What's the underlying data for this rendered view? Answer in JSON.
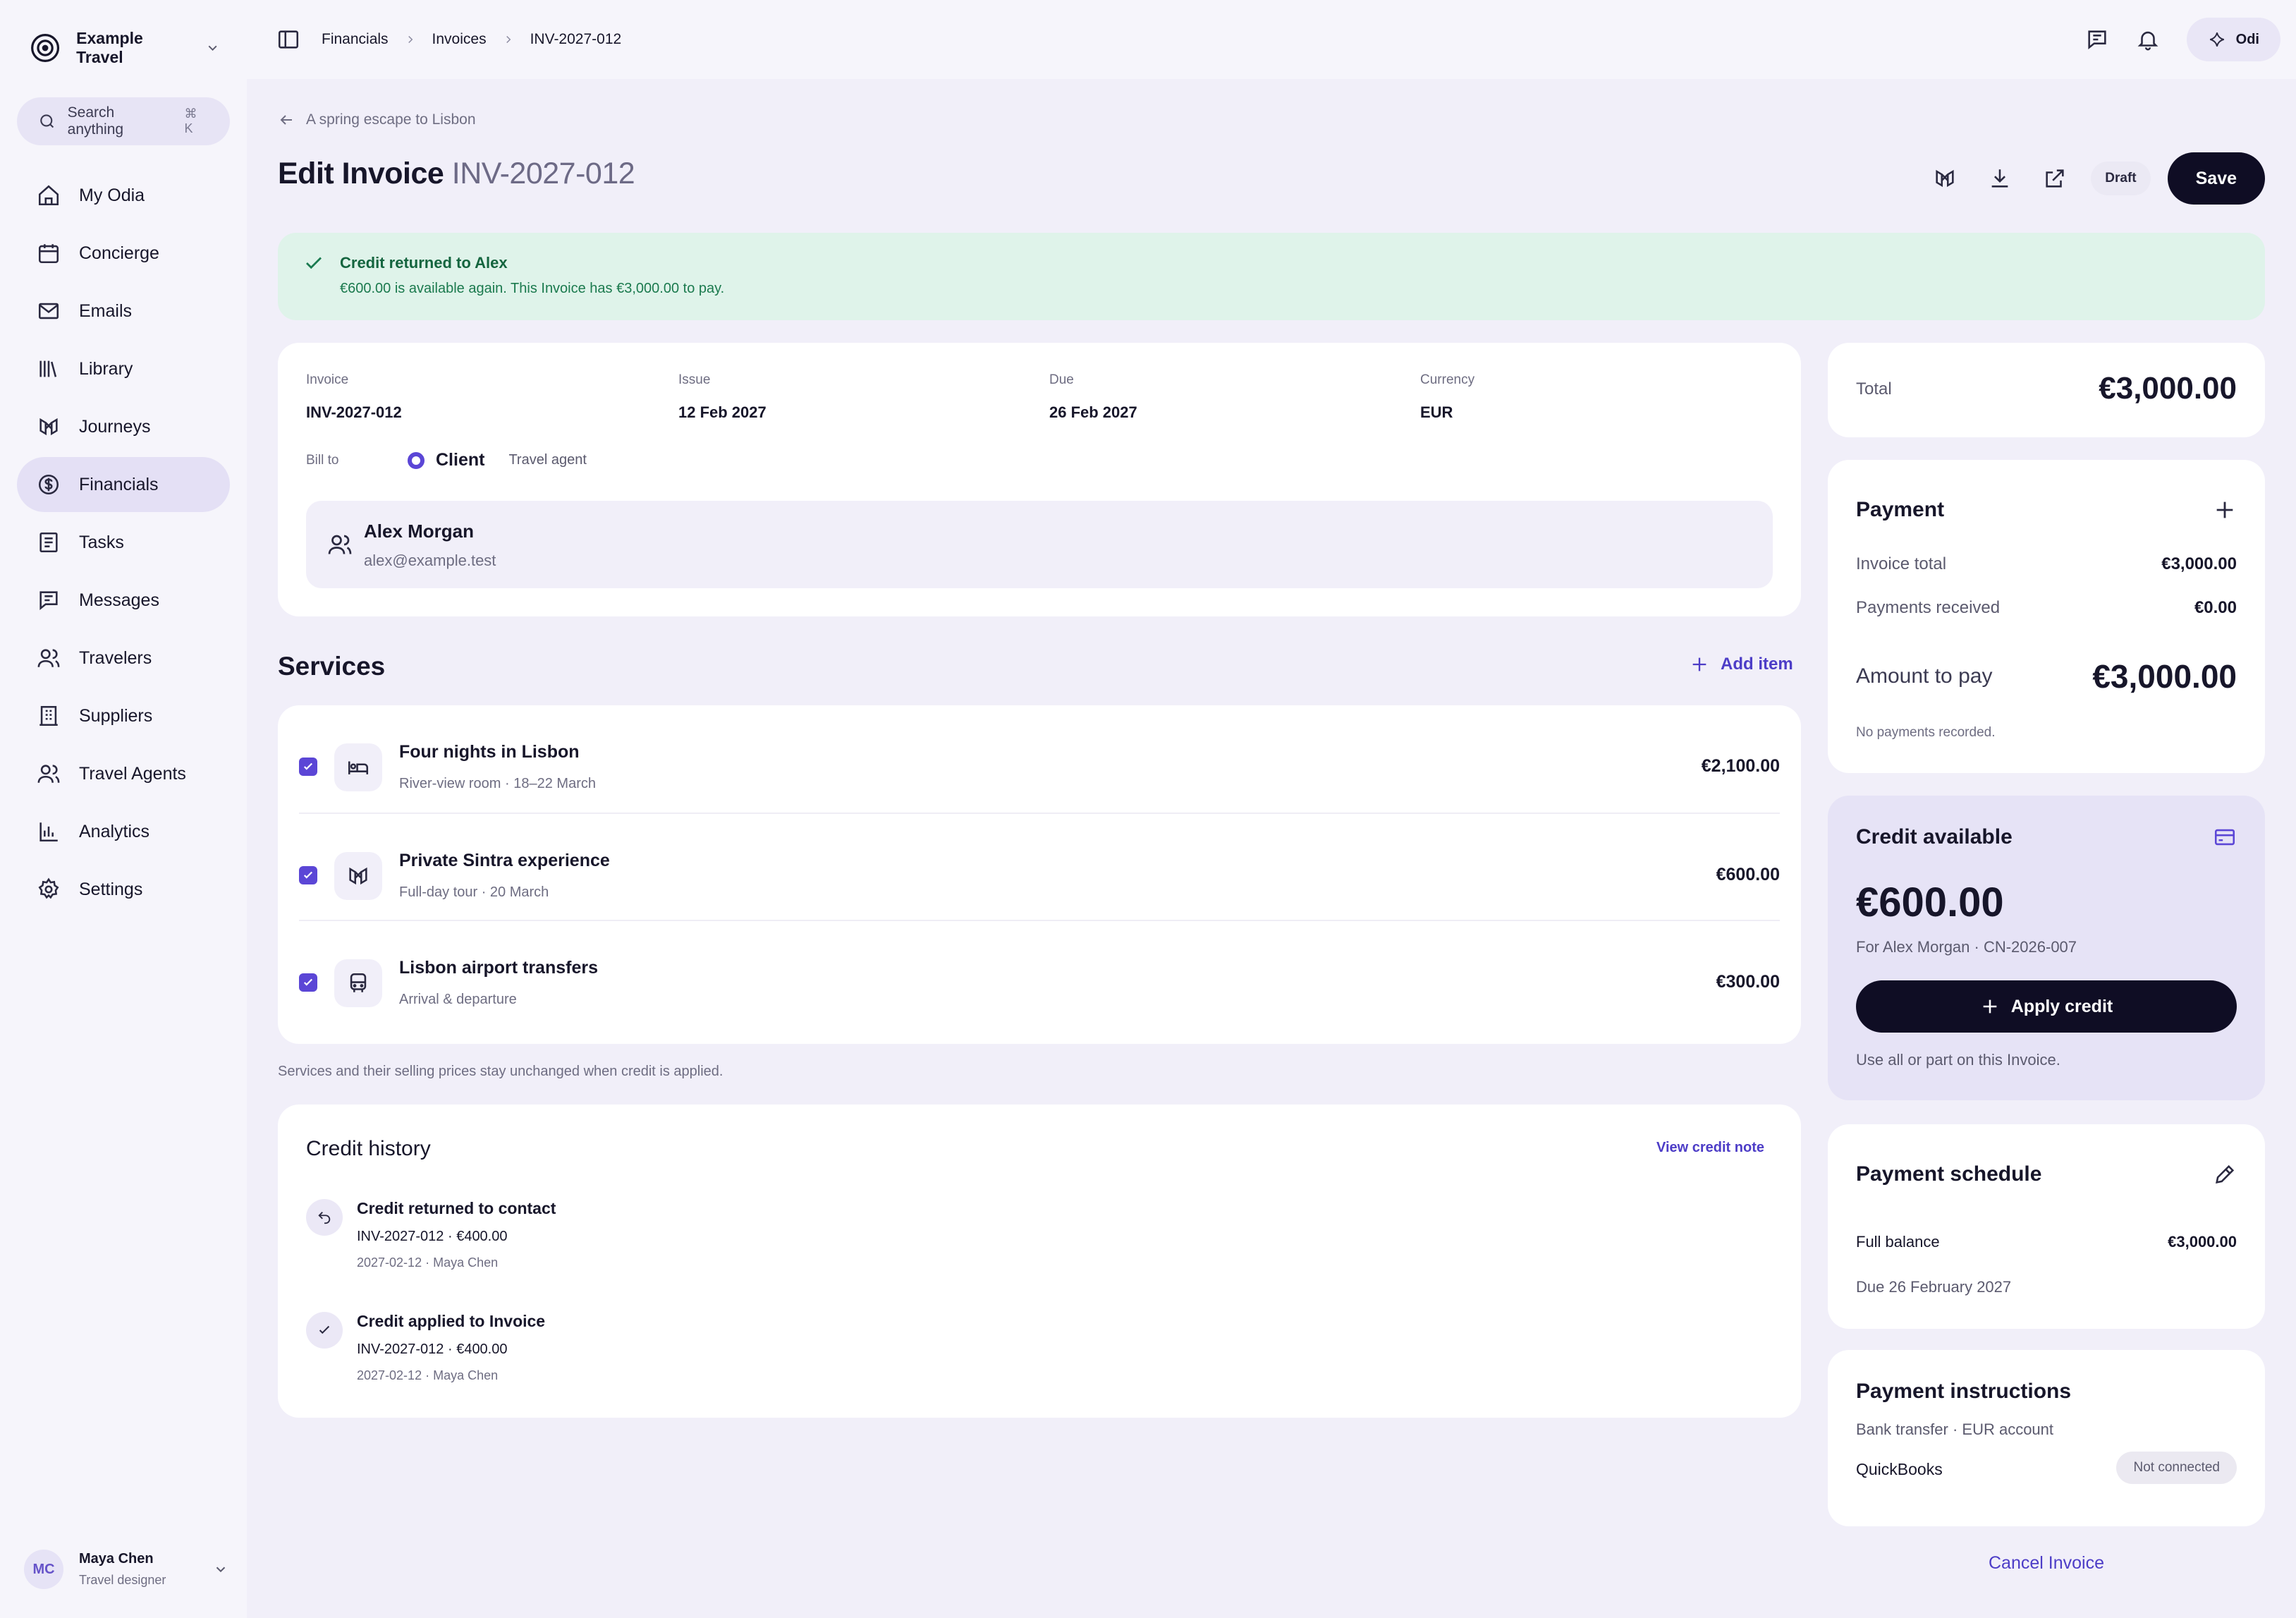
{
  "sidebar": {
    "brand": "Example Travel",
    "search_placeholder": "Search anything",
    "search_shortcut": "⌘ K",
    "items": [
      {
        "label": "My Odia",
        "icon": "home-icon"
      },
      {
        "label": "Concierge",
        "icon": "calendar-icon"
      },
      {
        "label": "Emails",
        "icon": "mail-icon"
      },
      {
        "label": "Library",
        "icon": "library-icon"
      },
      {
        "label": "Journeys",
        "icon": "journeys-icon"
      },
      {
        "label": "Financials",
        "icon": "dollar-circle-icon",
        "active": true
      },
      {
        "label": "Tasks",
        "icon": "tasks-icon"
      },
      {
        "label": "Messages",
        "icon": "message-icon"
      },
      {
        "label": "Travelers",
        "icon": "users-icon"
      },
      {
        "label": "Suppliers",
        "icon": "building-icon"
      },
      {
        "label": "Travel Agents",
        "icon": "agents-icon"
      },
      {
        "label": "Analytics",
        "icon": "bar-chart-icon"
      },
      {
        "label": "Settings",
        "icon": "gear-icon"
      }
    ],
    "user": {
      "initials": "MC",
      "name": "Maya Chen",
      "role": "Travel designer"
    }
  },
  "topbar": {
    "breadcrumbs": [
      "Financials",
      "Invoices",
      "INV-2027-012"
    ],
    "assistant_label": "Odi"
  },
  "page": {
    "back_label": "A spring escape to Lisbon",
    "title_prefix": "Edit Invoice",
    "title_id": "INV-2027-012",
    "status": "Draft",
    "save_label": "Save"
  },
  "banner": {
    "title": "Credit returned to Alex",
    "text": "€600.00 is available again. This Invoice has €3,000.00 to pay."
  },
  "details": {
    "fields": [
      {
        "label": "Invoice",
        "value": "INV-2027-012"
      },
      {
        "label": "Issue",
        "value": "12 Feb 2027"
      },
      {
        "label": "Due",
        "value": "26 Feb 2027"
      },
      {
        "label": "Currency",
        "value": "EUR"
      }
    ],
    "bill_to_label": "Bill to",
    "bill_to_selected": "Client",
    "bill_to_other": "Travel agent",
    "client_name": "Alex Morgan",
    "client_email": "alex@example.test"
  },
  "services": {
    "title": "Services",
    "add_label": "Add item",
    "items": [
      {
        "name": "Four nights in Lisbon",
        "desc": "River-view room · 18–22 March",
        "price": "€2,100.00",
        "icon": "bed-icon"
      },
      {
        "name": "Private Sintra experience",
        "desc": "Full-day tour · 20 March",
        "price": "€600.00",
        "icon": "journeys-icon"
      },
      {
        "name": "Lisbon airport transfers",
        "desc": "Arrival & departure",
        "price": "€300.00",
        "icon": "bus-icon"
      }
    ],
    "note": "Services and their selling prices stay unchanged when credit is applied."
  },
  "history": {
    "title": "Credit history",
    "link": "View credit note",
    "items": [
      {
        "title": "Credit returned to contact",
        "sub": "INV-2027-012 · €400.00",
        "meta": "2027-02-12 · Maya Chen",
        "icon": "undo-icon"
      },
      {
        "title": "Credit applied to Invoice",
        "sub": "INV-2027-012 · €400.00",
        "meta": "2027-02-12 · Maya Chen",
        "icon": "check-icon"
      }
    ]
  },
  "summary": {
    "total_label": "Total",
    "total_value": "€3,000.00"
  },
  "payment": {
    "title": "Payment",
    "invoice_total_label": "Invoice total",
    "invoice_total_value": "€3,000.00",
    "received_label": "Payments received",
    "received_value": "€0.00",
    "to_pay_label": "Amount to pay",
    "to_pay_value": "€3,000.00",
    "note": "No payments recorded."
  },
  "credit": {
    "title": "Credit available",
    "amount": "€600.00",
    "for": "For Alex Morgan · CN-2026-007",
    "apply_label": "Apply credit",
    "hint": "Use all or part on this Invoice."
  },
  "schedule": {
    "title": "Payment schedule",
    "label": "Full balance",
    "value": "€3,000.00",
    "due": "Due 26 February 2027"
  },
  "instructions": {
    "title": "Payment instructions",
    "sub": "Bank transfer · EUR account",
    "integration": "QuickBooks",
    "integration_status": "Not connected"
  },
  "cancel_label": "Cancel Invoice",
  "colors": {
    "accent": "#5b46d6",
    "dark": "#0f0d24",
    "success_bg": "#dff3ea",
    "success_text": "#14653f",
    "page_bg": "#f1eff9"
  }
}
